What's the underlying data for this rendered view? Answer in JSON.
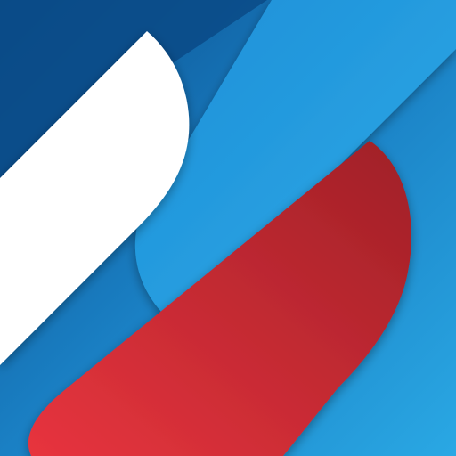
{
  "artwork": {
    "colors": {
      "background_dark": "#0b4f8f",
      "background_mid": "#1a80c4",
      "background_light": "#2aa8e4",
      "white_band": "#ffffff",
      "blue_band_top": "#1d8fd8",
      "blue_band_bottom": "#2eaae6",
      "red_band_top": "#9f2027",
      "red_band_bottom": "#e8343e"
    },
    "bands": [
      "white-band",
      "blue-band",
      "red-band"
    ]
  }
}
